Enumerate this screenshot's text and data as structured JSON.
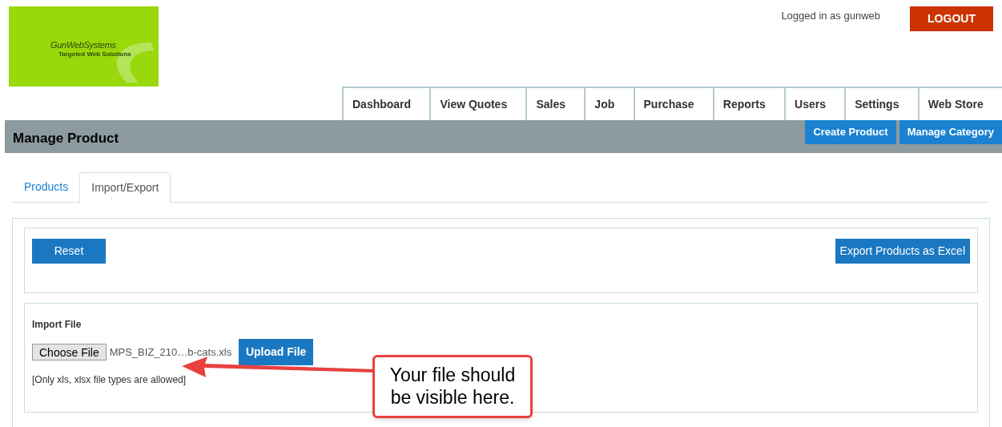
{
  "logo": {
    "name": "GunWebSystems",
    "tagline": "Targeted Web Solutions"
  },
  "user": {
    "text": "Logged in as gunweb",
    "logout": "LOGOUT"
  },
  "nav": [
    {
      "label": "Dashboard"
    },
    {
      "label": "View Quotes"
    },
    {
      "label": "Sales"
    },
    {
      "label": "Job"
    },
    {
      "label": "Purchase"
    },
    {
      "label": "Reports"
    },
    {
      "label": "Users"
    },
    {
      "label": "Settings"
    },
    {
      "label": "Web Store"
    }
  ],
  "header": {
    "title": "Manage Product",
    "actions": [
      "Create Product",
      "Manage Category"
    ]
  },
  "tabs": [
    {
      "label": "Products",
      "selected": false
    },
    {
      "label": "Import/Export",
      "selected": true
    }
  ],
  "toolbar": {
    "reset": "Reset",
    "export": "Export Products as Excel"
  },
  "import": {
    "label": "Import File",
    "choose": "Choose File",
    "file_name": "MPS_BIZ_210…b-cats.xls",
    "upload": "Upload File",
    "hint": "[Only xls, xlsx file types are allowed]"
  },
  "callout": {
    "text": "Your file should be visible here."
  }
}
